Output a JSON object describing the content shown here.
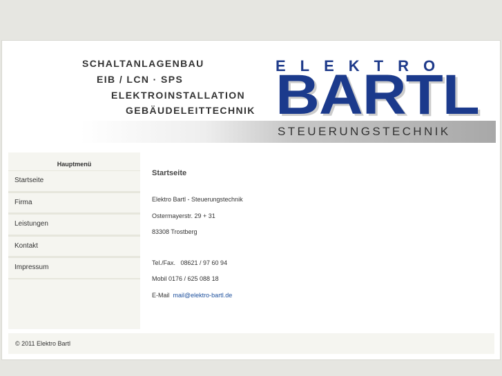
{
  "banner": {
    "taglines": [
      "SCHALTANLAGENBAU",
      "EIB / LCN · SPS",
      "ELEKTROINSTALLATION",
      "GEBÄUDELEITTECHNIK"
    ],
    "logo_top": "ELEKTRO",
    "logo_main": "BARTL",
    "logo_sub": "STEUERUNGSTECHNIK"
  },
  "sidebar": {
    "title": "Hauptmenü",
    "items": [
      "Startseite",
      "Firma",
      "Leistungen",
      "Kontakt",
      "Impressum"
    ]
  },
  "main": {
    "title": "Startseite",
    "company": "Elektro Bartl - Steuerungstechnik",
    "street": "Ostermayerstr. 29 + 31",
    "city": "83308 Trostberg",
    "tel": "Tel./Fax.   08621 / 97 60 94",
    "mobil": "Mobil 0176 / 625 088 18",
    "email_label": "E-Mail",
    "email": "mail@elektro-bartl.de"
  },
  "footer": {
    "copyright": "© 2011 Elektro Bartl"
  }
}
